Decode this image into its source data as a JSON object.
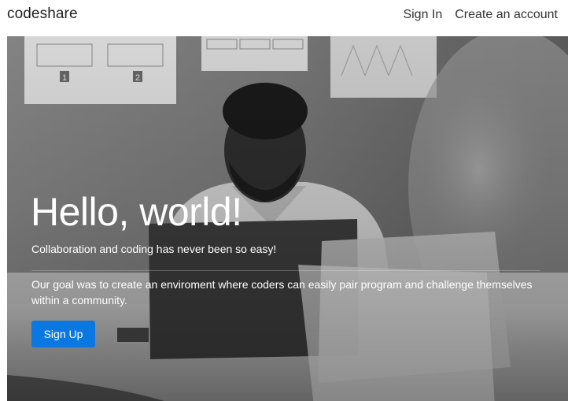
{
  "navbar": {
    "brand": "codeshare",
    "links": [
      {
        "label": "Sign In"
      },
      {
        "label": "Create an account"
      }
    ]
  },
  "hero": {
    "title": "Hello, world!",
    "lead": "Collaboration and coding has never been so easy!",
    "description": "Our goal was to create an enviroment where coders can easily pair program and challenge themselves within a community.",
    "signup_label": "Sign Up",
    "photo_placeholder_digits": [
      "1",
      "2"
    ]
  },
  "colors": {
    "primary": "#0a78e0",
    "text_dark": "#222222"
  }
}
